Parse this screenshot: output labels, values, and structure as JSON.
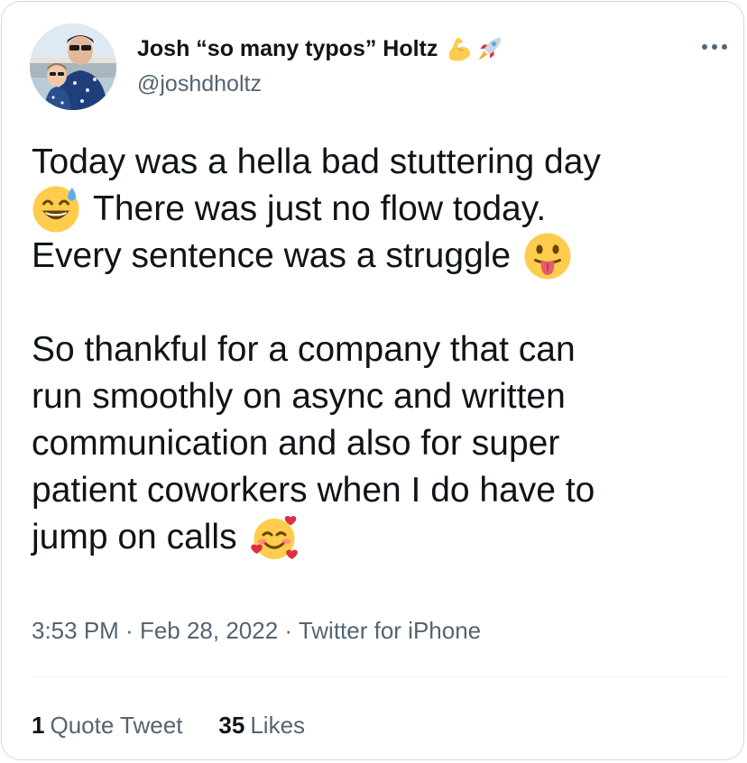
{
  "author": {
    "name": "Josh “so many typos” Holtz",
    "name_emojis": [
      "flexed-biceps-icon",
      "rocket-icon"
    ],
    "handle": "@joshdholtz"
  },
  "tweet": {
    "lines": [
      {
        "text": "Today was a hella bad stuttering day",
        "emoji_before": null,
        "emoji_after": null
      },
      {
        "text": "There was just no flow today.",
        "emoji_before": "grinning-sweat-face-icon",
        "emoji_after": null
      },
      {
        "text": "Every sentence was a struggle",
        "emoji_before": null,
        "emoji_after": "tongue-out-face-icon"
      },
      {
        "text": "",
        "emoji_before": null,
        "emoji_after": null
      },
      {
        "text": "So thankful for a company that can",
        "emoji_before": null,
        "emoji_after": null
      },
      {
        "text": "run smoothly on async and written",
        "emoji_before": null,
        "emoji_after": null
      },
      {
        "text": "communication and also for super",
        "emoji_before": null,
        "emoji_after": null
      },
      {
        "text": "patient coworkers when I do have to",
        "emoji_before": null,
        "emoji_after": null
      },
      {
        "text": "jump on calls",
        "emoji_before": null,
        "emoji_after": "smiling-face-with-hearts-icon"
      }
    ]
  },
  "meta": {
    "time": "3:53 PM",
    "sep1": " · ",
    "date": "Feb 28, 2022",
    "sep2": " · ",
    "source": "Twitter for iPhone"
  },
  "stats": {
    "quote_count": "1",
    "quote_label": "Quote Tweet",
    "like_count": "35",
    "like_label": "Likes"
  },
  "colors": {
    "text": "#0f1419",
    "secondary": "#536471",
    "border": "#cfd9de",
    "divider": "#eff3f4",
    "emoji_yellow": "#ffcc4d"
  }
}
